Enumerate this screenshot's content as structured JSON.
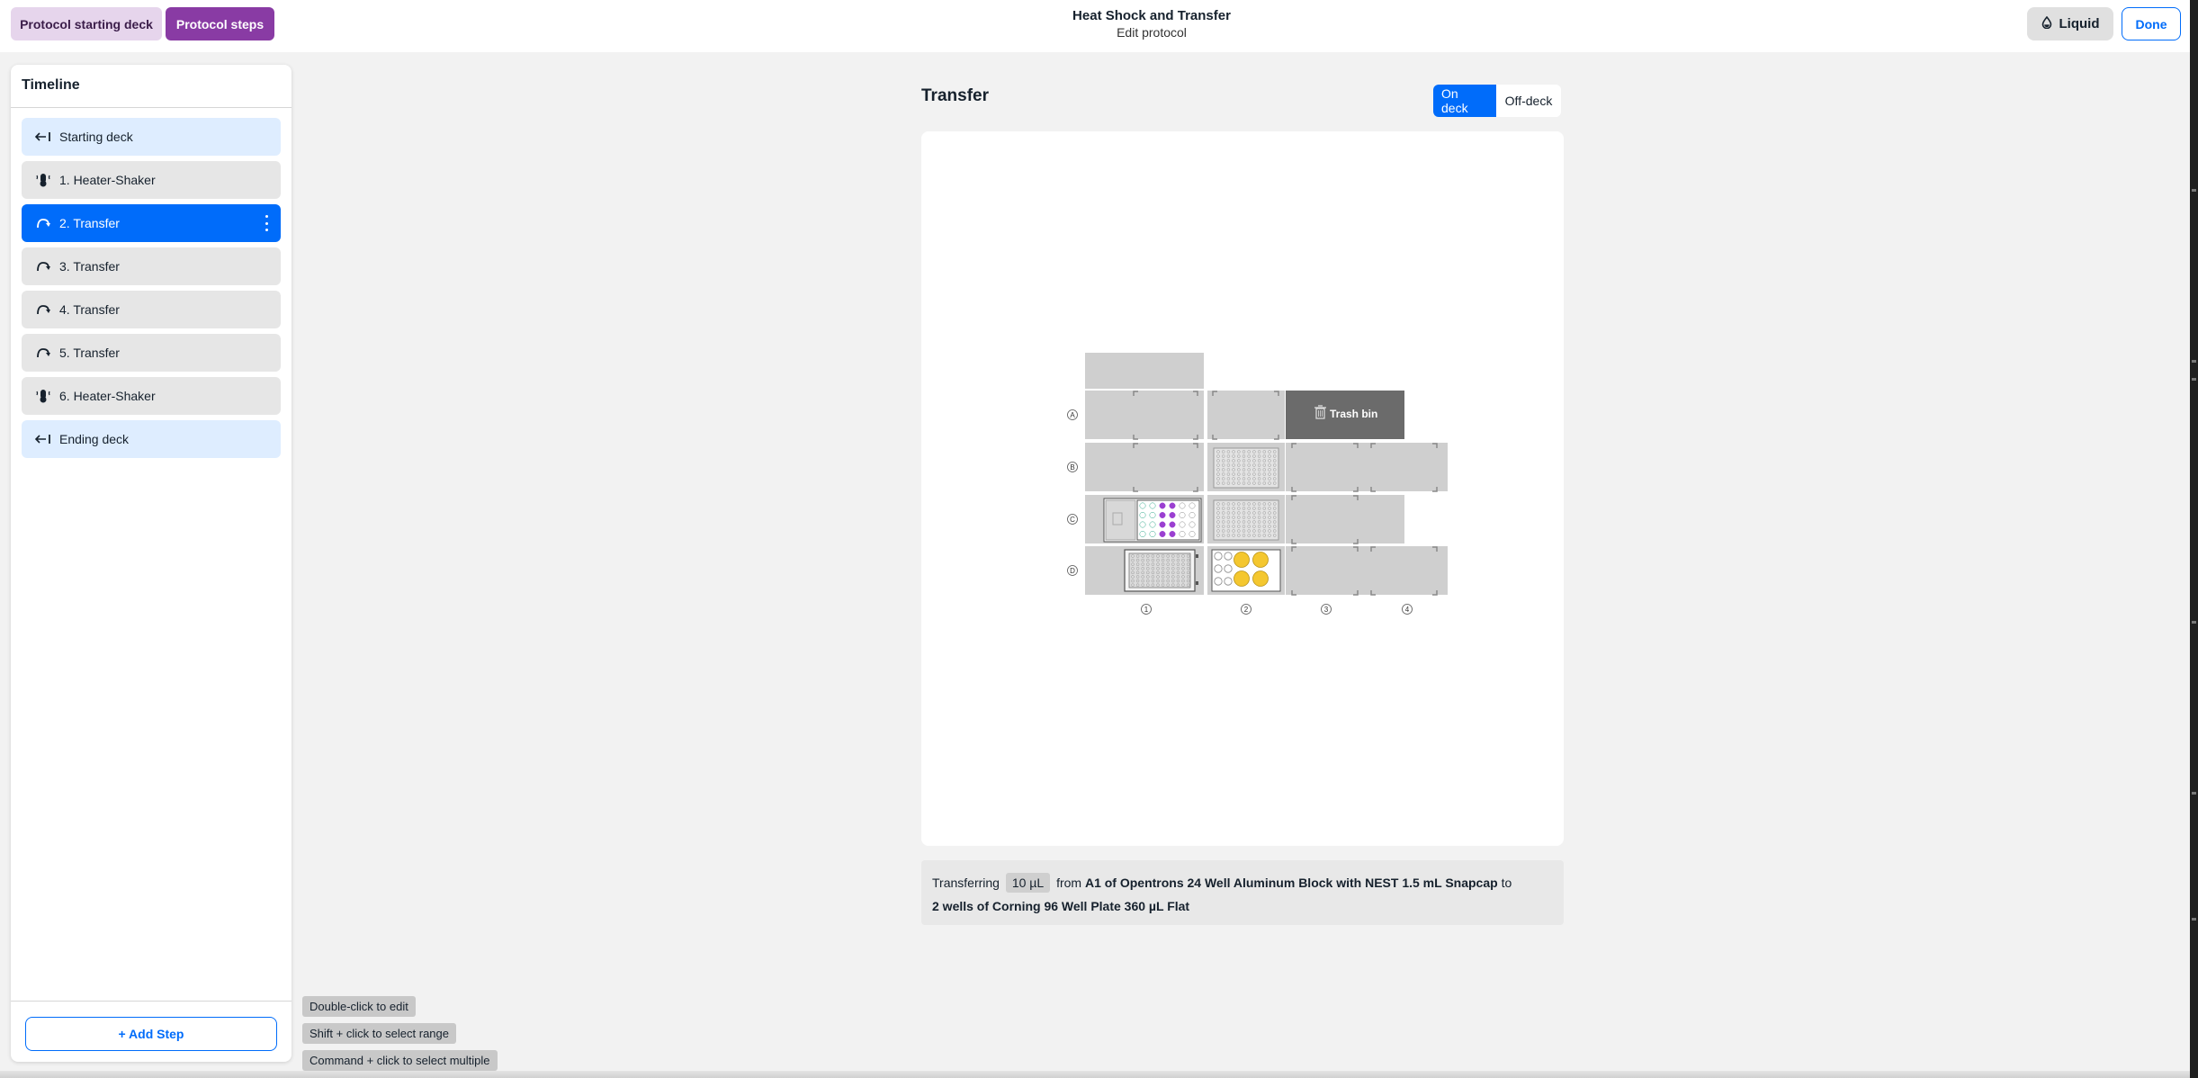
{
  "header": {
    "tab_starting_deck": "Protocol starting deck",
    "tab_steps": "Protocol steps",
    "protocol_title": "Heat Shock and Transfer",
    "protocol_subtitle": "Edit protocol",
    "liquid_label": "Liquid",
    "done_label": "Done",
    "colors": {
      "steps_tab": "#893ba4",
      "deck_tab": "#e6d5ec",
      "accent": "#006cfa"
    }
  },
  "sidebar": {
    "title": "Timeline",
    "items": [
      {
        "label": "Starting deck",
        "icon": "arrow-left-bar-icon",
        "state": "terminal"
      },
      {
        "label": "1. Heater-Shaker",
        "icon": "heater-shaker-icon",
        "state": "default"
      },
      {
        "label": "2. Transfer",
        "icon": "transfer-curve-icon",
        "state": "selected"
      },
      {
        "label": "3. Transfer",
        "icon": "transfer-curve-icon",
        "state": "default"
      },
      {
        "label": "4. Transfer",
        "icon": "transfer-curve-icon",
        "state": "default"
      },
      {
        "label": "5. Transfer",
        "icon": "transfer-curve-icon",
        "state": "default"
      },
      {
        "label": "6. Heater-Shaker",
        "icon": "heater-shaker-icon",
        "state": "default"
      },
      {
        "label": "Ending deck",
        "icon": "arrow-left-bar-icon",
        "state": "terminal"
      }
    ],
    "add_step_label": "+ Add Step"
  },
  "main": {
    "title": "Transfer",
    "toggle": {
      "on_deck": "On deck",
      "off_deck": "Off-deck",
      "selected": "On deck"
    },
    "deck": {
      "row_labels": [
        "A",
        "B",
        "C",
        "D"
      ],
      "column_labels": [
        "1",
        "2",
        "3",
        "4"
      ],
      "trash_label": "Trash bin",
      "liquid_colors": {
        "purple": "#9b3fd1",
        "green": "#2fa88b",
        "yellow": "#f4c72f"
      }
    },
    "transfer": {
      "prefix": "Transferring",
      "volume": "10 µL",
      "from_word": "from",
      "source": "A1 of Opentrons 24 Well Aluminum Block with NEST 1.5 mL Snapcap",
      "to_word": "to",
      "destination": "2 wells of Corning 96 Well Plate 360 µL Flat"
    }
  },
  "hints": [
    "Double-click to edit",
    "Shift + click to select range",
    "Command + click to select multiple"
  ]
}
